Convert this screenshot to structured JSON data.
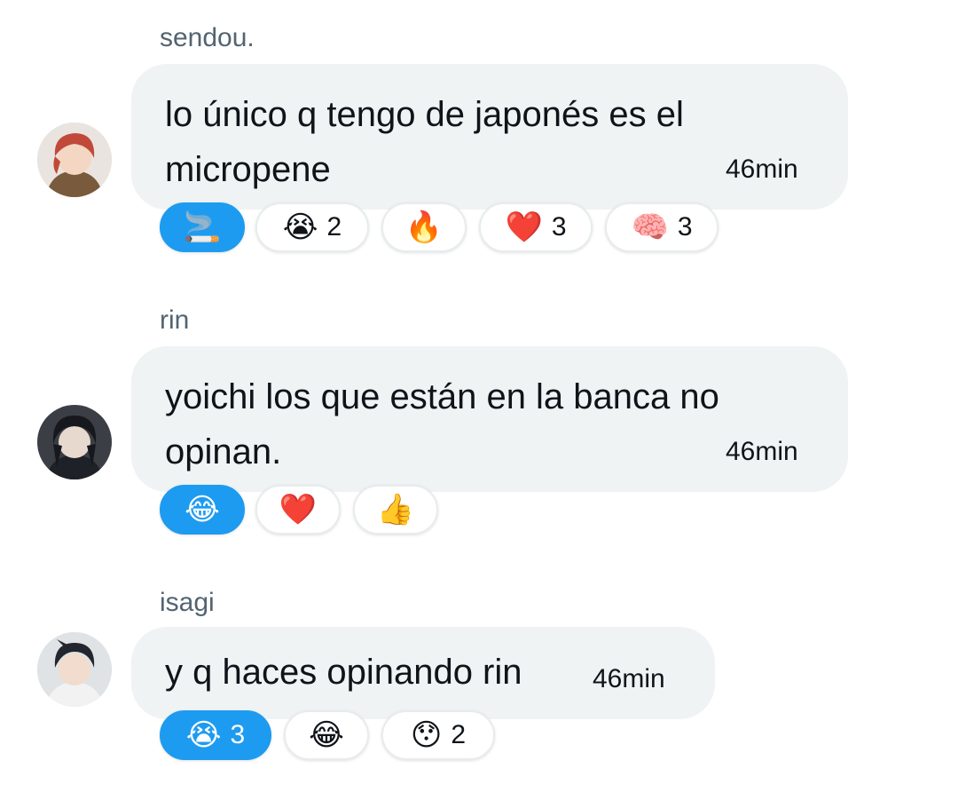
{
  "messages": [
    {
      "sender": "sendou.",
      "text": "lo único q tengo de japonés es el\nmicropene",
      "time": "46min",
      "reactions": [
        {
          "emoji": "🚬",
          "count": "",
          "mine": true
        },
        {
          "emoji": "😭",
          "count": "2",
          "mine": false
        },
        {
          "emoji": "🔥",
          "count": "",
          "mine": false
        },
        {
          "emoji": "❤️",
          "count": "3",
          "mine": false
        },
        {
          "emoji": "🧠",
          "count": "3",
          "mine": false
        }
      ]
    },
    {
      "sender": "rin",
      "text": "yoichi los que están en la banca no\nopinan.",
      "time": "46min",
      "reactions": [
        {
          "emoji": "😂",
          "count": "",
          "mine": true
        },
        {
          "emoji": "❤️",
          "count": "",
          "mine": false
        },
        {
          "emoji": "👍",
          "count": "",
          "mine": false
        }
      ]
    },
    {
      "sender": "isagi",
      "text": "y q haces opinando rin",
      "time": "46min",
      "reactions": [
        {
          "emoji": "😭",
          "count": "3",
          "mine": true
        },
        {
          "emoji": "😂",
          "count": "",
          "mine": false
        },
        {
          "emoji": "😯",
          "count": "2",
          "mine": false
        }
      ]
    }
  ],
  "colors": {
    "bubble": "#eff3f4",
    "accent": "#1d9bf0",
    "muted": "#536471"
  }
}
